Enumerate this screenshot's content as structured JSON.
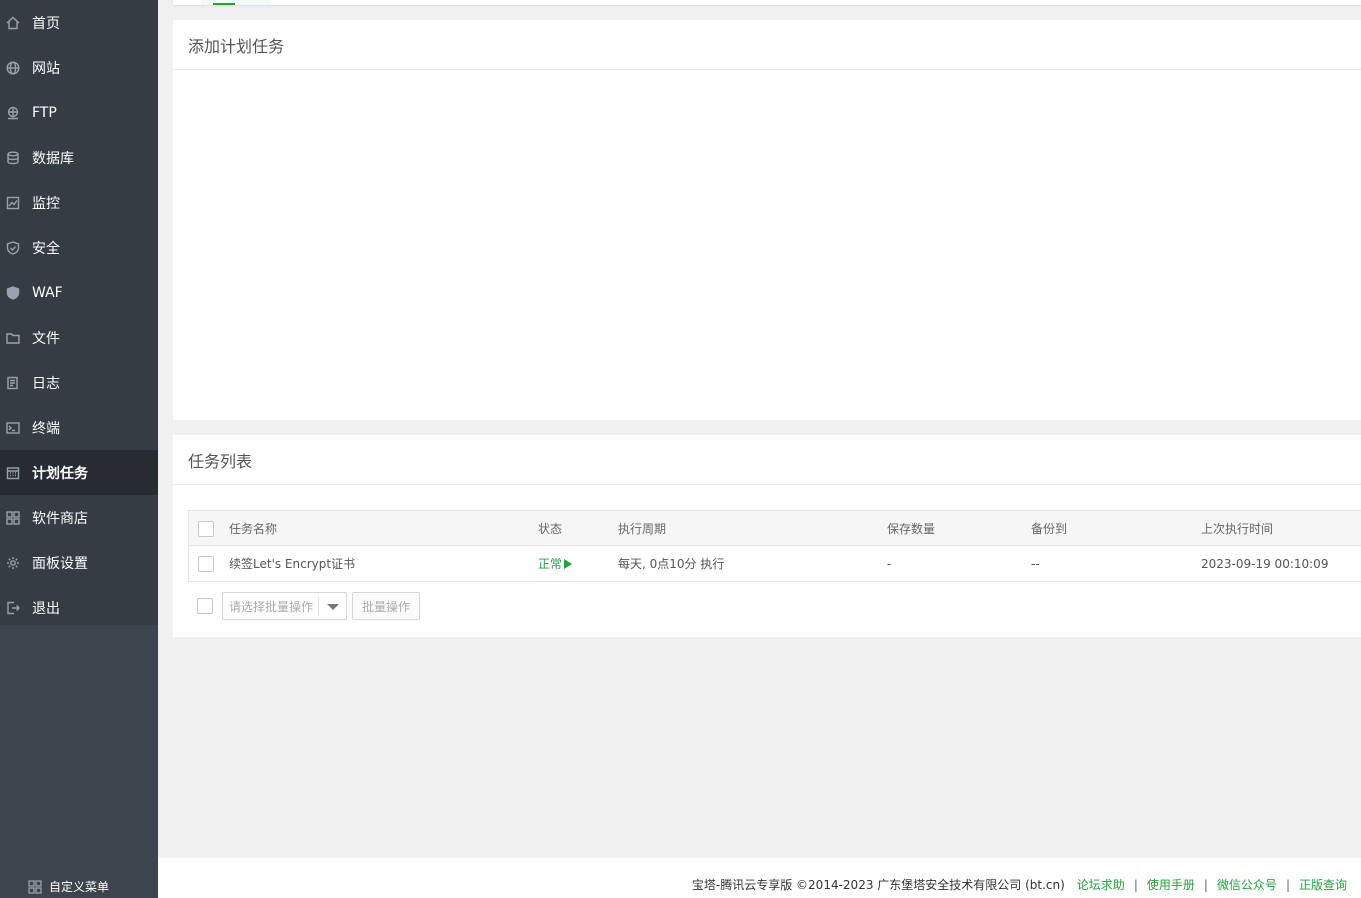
{
  "sidebar": {
    "items": [
      {
        "label": "首页",
        "icon": "home-icon"
      },
      {
        "label": "网站",
        "icon": "globe-icon"
      },
      {
        "label": "FTP",
        "icon": "ftp-icon"
      },
      {
        "label": "数据库",
        "icon": "database-icon"
      },
      {
        "label": "监控",
        "icon": "monitor-chart-icon"
      },
      {
        "label": "安全",
        "icon": "shield-icon"
      },
      {
        "label": "WAF",
        "icon": "waf-shield-icon"
      },
      {
        "label": "文件",
        "icon": "folder-icon"
      },
      {
        "label": "日志",
        "icon": "log-icon"
      },
      {
        "label": "终端",
        "icon": "terminal-icon"
      },
      {
        "label": "计划任务",
        "icon": "calendar-icon",
        "active": true
      },
      {
        "label": "软件商店",
        "icon": "apps-grid-icon"
      },
      {
        "label": "面板设置",
        "icon": "gear-icon"
      },
      {
        "label": "退出",
        "icon": "logout-icon"
      }
    ],
    "custom_menu_label": "自定义菜单"
  },
  "add_panel": {
    "title": "添加计划任务"
  },
  "list_panel": {
    "title": "任务列表",
    "columns": [
      "任务名称",
      "状态",
      "执行周期",
      "保存数量",
      "备份到",
      "上次执行时间"
    ],
    "rows": [
      {
        "name": "续签Let's Encrypt证书",
        "status": "正常",
        "cycle": "每天, 0点10分 执行",
        "save_count": "-",
        "backup_to": "--",
        "last_run": "2023-09-19 00:10:09"
      }
    ],
    "batch_placeholder": "请选择批量操作",
    "batch_button": "批量操作"
  },
  "footer": {
    "copyright": "宝塔-腾讯云专享版 ©2014-2023 广东堡塔安全技术有限公司 (bt.cn)",
    "links": [
      "论坛求助",
      "使用手册",
      "微信公众号",
      "正版查询"
    ]
  },
  "colors": {
    "accent": "#20a53a",
    "sidebar_bg": "#3c444d",
    "active_item_bg": "#272c32"
  }
}
